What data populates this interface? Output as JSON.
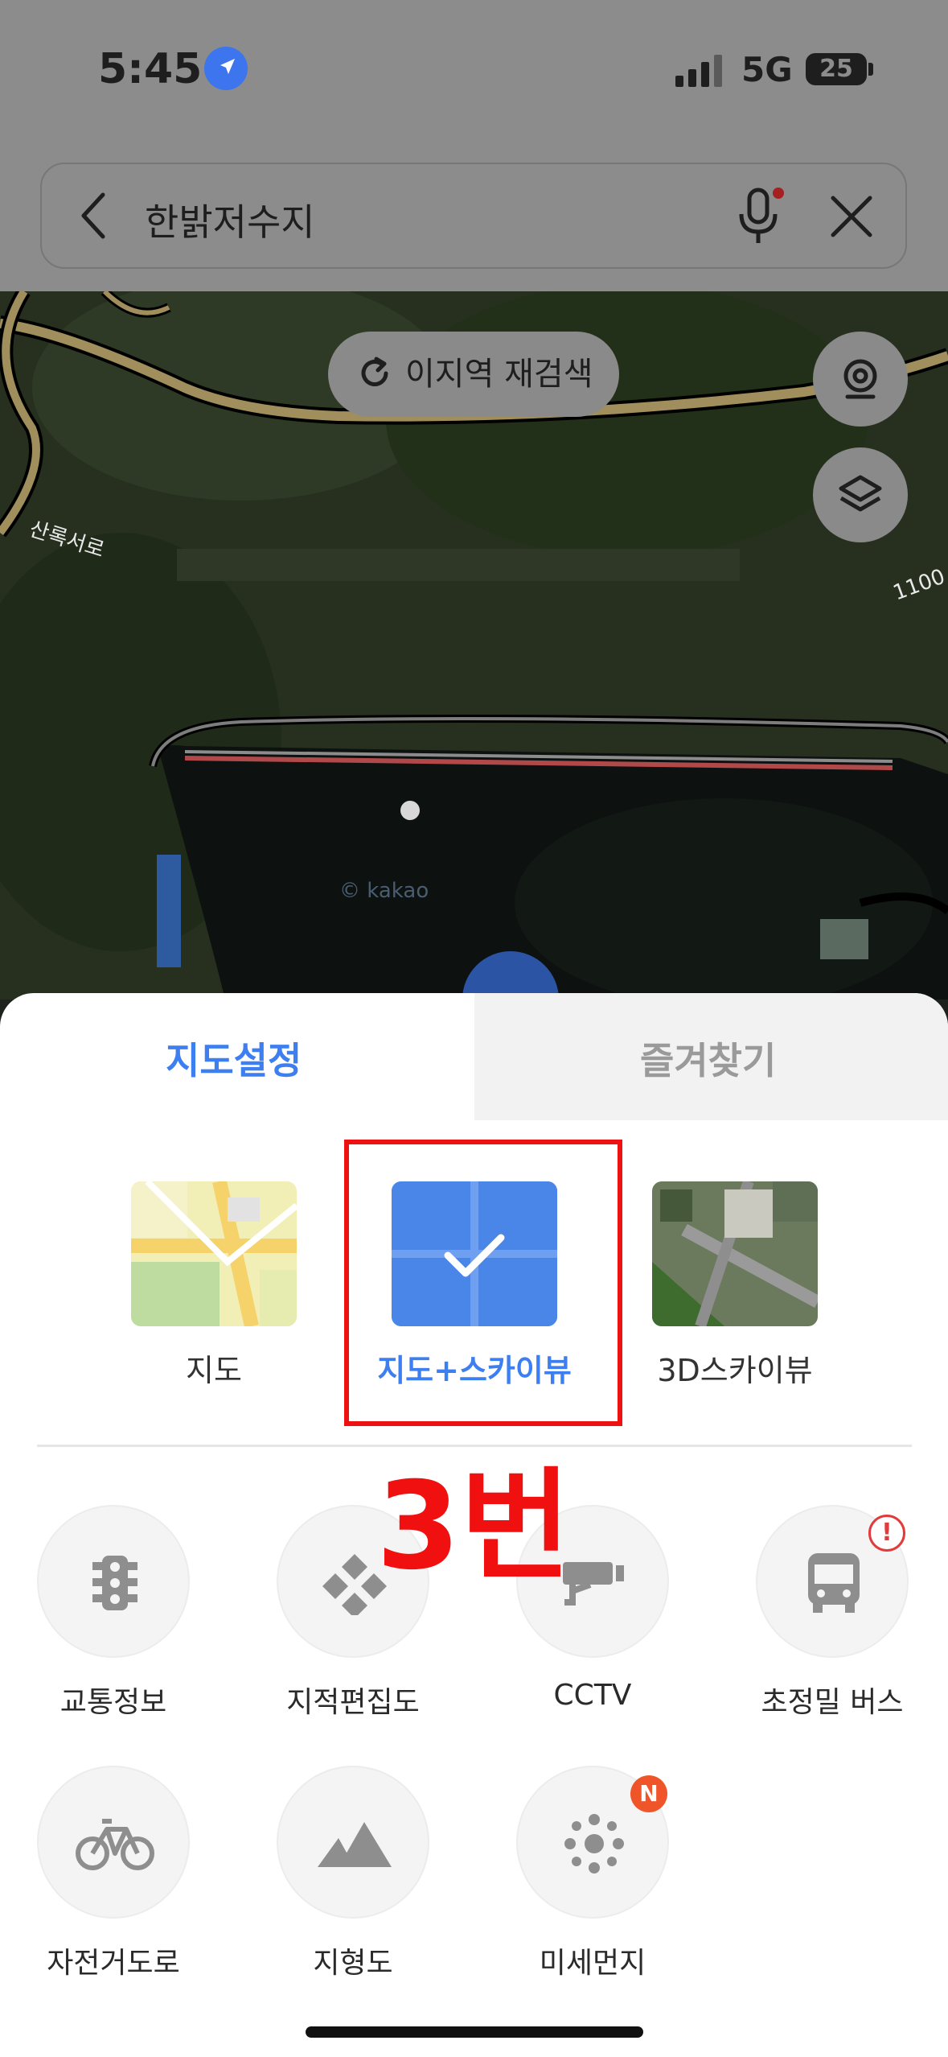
{
  "status": {
    "time": "5:45",
    "network": "5G",
    "battery": "25"
  },
  "search": {
    "query": "한밝저수지"
  },
  "map": {
    "research_button": "이지역 재검색",
    "road_label_1": "산록서로",
    "road_label_2": "1100",
    "watermark": "© kakao"
  },
  "sheet": {
    "tabs": [
      {
        "label": "지도설정",
        "active": true
      },
      {
        "label": "즐겨찾기",
        "active": false
      }
    ],
    "map_types": [
      {
        "label": "지도",
        "selected": false
      },
      {
        "label": "지도+스카이뷰",
        "selected": true
      },
      {
        "label": "3D스카이뷰",
        "selected": false
      }
    ],
    "annotation": "3번",
    "features": [
      {
        "label": "교통정보",
        "icon": "traffic-light-icon"
      },
      {
        "label": "지적편집도",
        "icon": "cadastral-icon"
      },
      {
        "label": "CCTV",
        "icon": "cctv-icon"
      },
      {
        "label": "초정밀 버스",
        "icon": "bus-icon",
        "badge": "!"
      },
      {
        "label": "자전거도로",
        "icon": "bicycle-icon"
      },
      {
        "label": "지형도",
        "icon": "terrain-icon"
      },
      {
        "label": "미세먼지",
        "icon": "dust-icon",
        "badge": "N"
      }
    ]
  },
  "colors": {
    "accent": "#3d7ff0",
    "annotation": "#f01010",
    "badge_new": "#f0552a"
  }
}
